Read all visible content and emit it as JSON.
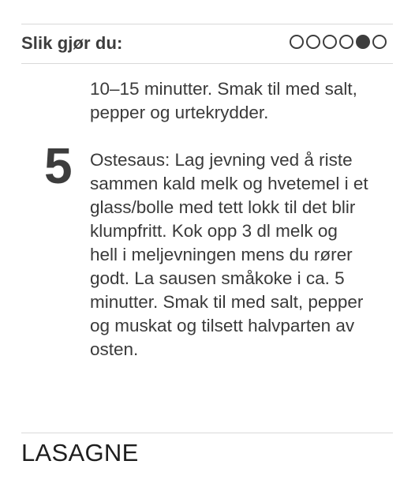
{
  "section": {
    "title": "Slik gjør du:"
  },
  "pager": {
    "total": 6,
    "active_index": 4
  },
  "steps": {
    "previous_continuation": "10–15 minutter. Smak til med salt,\npepper og urtekrydder.",
    "current": {
      "number": "5",
      "text": "Ostesaus: Lag jevning ved å riste\nsammen kald melk og hvetemel i et\nglass/bolle med tett lokk til det blir\nklumpfritt. Kok opp 3 dl melk og\nhell i meljevningen mens du rører\ngodt. La sausen småkoke i ca. 5\nminutter. Smak til med salt, pepper\nog muskat og tilsett halvparten av\nosten."
    }
  },
  "next_section": {
    "title": "LASAGNE"
  },
  "colors": {
    "text": "#3a3a3a",
    "accent": "#3d3d3d",
    "divider": "#d9d9d9"
  }
}
